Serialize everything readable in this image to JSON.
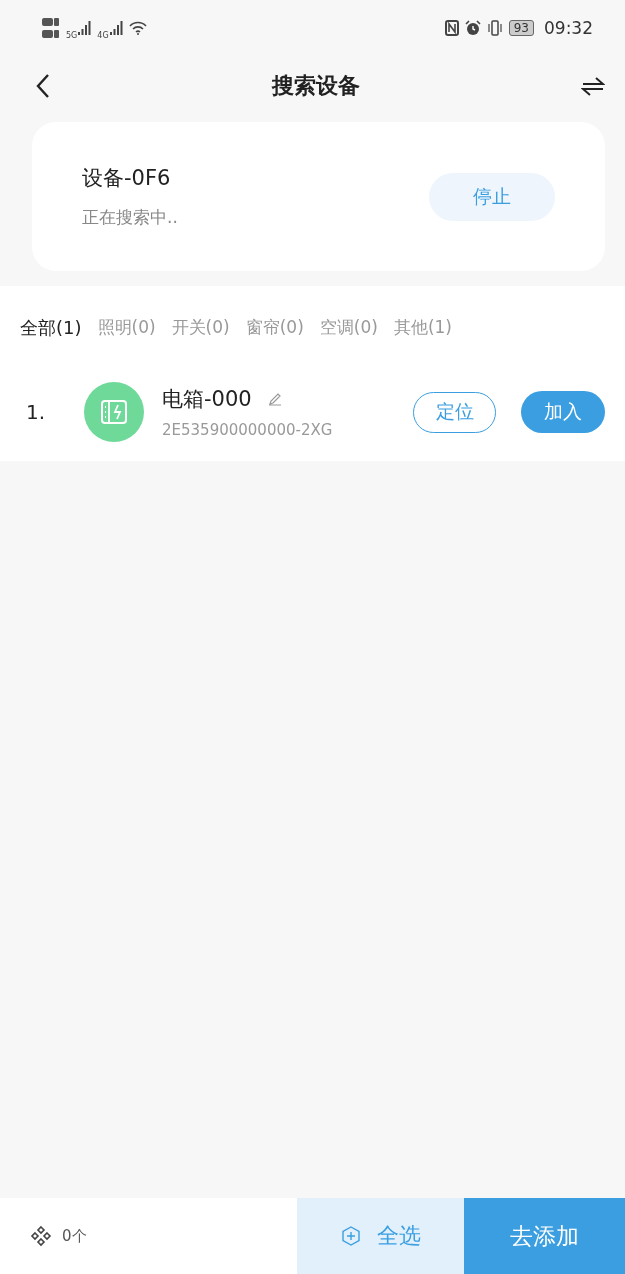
{
  "status_bar": {
    "networks": [
      "5G",
      "4G"
    ],
    "battery": "93",
    "time": "09:32"
  },
  "header": {
    "title": "搜索设备"
  },
  "search_card": {
    "device": "设备-0F6",
    "status": "正在搜索中..",
    "stop_button": "停止"
  },
  "tabs": [
    {
      "label": "全部(1)",
      "selected": true
    },
    {
      "label": "照明(0)",
      "selected": false
    },
    {
      "label": "开关(0)",
      "selected": false
    },
    {
      "label": "窗帘(0)",
      "selected": false
    },
    {
      "label": "空调(0)",
      "selected": false
    },
    {
      "label": "其他(1)",
      "selected": false
    }
  ],
  "devices": [
    {
      "index": "1.",
      "name": "电箱-000",
      "serial": "2E535900000000-2XG",
      "locate_button": "定位",
      "add_button": "加入"
    }
  ],
  "bottom_bar": {
    "count": "0个",
    "select_all": "全选",
    "submit": "去添加"
  }
}
